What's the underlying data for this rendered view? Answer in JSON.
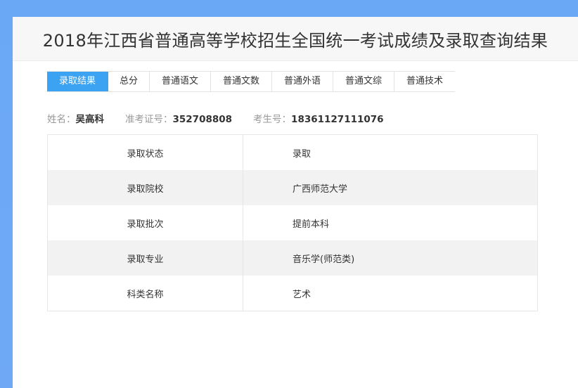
{
  "title": "2018年江西省普通高等学校招生全国统一考试成绩及录取查询结果",
  "tabs": [
    {
      "label": "录取结果"
    },
    {
      "label": "总分"
    },
    {
      "label": "普通语文"
    },
    {
      "label": "普通文数"
    },
    {
      "label": "普通外语"
    },
    {
      "label": "普通文综"
    },
    {
      "label": "普通技术"
    }
  ],
  "active_tab_color": "#3ba3f1",
  "info": {
    "name_label": "姓名：",
    "name": "吴高科",
    "exam_label": "准考证号：",
    "exam_no": "352708808",
    "student_label": "考生号：",
    "student_no": "18361127111076"
  },
  "rows": [
    {
      "key": "录取状态",
      "value": "录取"
    },
    {
      "key": "录取院校",
      "value": "广西师范大学"
    },
    {
      "key": "录取批次",
      "value": "提前本科"
    },
    {
      "key": "录取专业",
      "value": "音乐学(师范类)"
    },
    {
      "key": "科类名称",
      "value": "艺术"
    }
  ]
}
